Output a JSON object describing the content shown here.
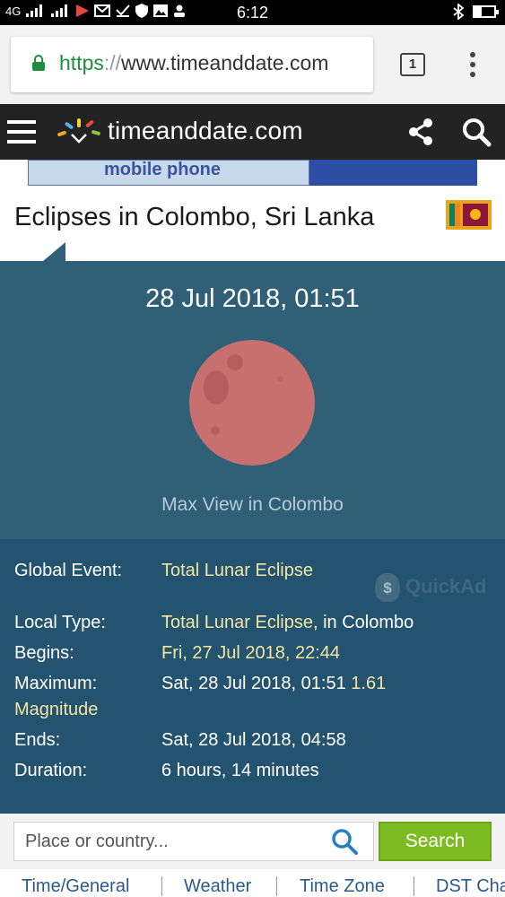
{
  "status_bar": {
    "network": "4G",
    "time": "6:12"
  },
  "browser": {
    "url_scheme": "https",
    "url_separator": "://",
    "url_host": "www.timeanddate.com",
    "tab_count": "1"
  },
  "site": {
    "name": "timeanddate.com"
  },
  "ad": {
    "text": "mobile phone"
  },
  "page": {
    "title": "Eclipses in Colombo, Sri Lanka"
  },
  "eclipse": {
    "datetime": "28 Jul 2018, 01:51",
    "caption": "Max View in Colombo"
  },
  "details": {
    "global_event_label": "Global Event:",
    "global_event_value": "Total Lunar Eclipse",
    "local_type_label": "Local Type:",
    "local_type_value": "Total Lunar Eclipse",
    "local_type_suffix": ", in Colombo",
    "begins_label": "Begins:",
    "begins_value": "Fri, 27 Jul 2018, 22:44",
    "maximum_label": "Maximum:",
    "maximum_value": "Sat, 28 Jul 2018, 01:51",
    "maximum_magnitude_value": "1.61",
    "magnitude_label": "Magnitude",
    "ends_label": "Ends:",
    "ends_value": "Sat, 28 Jul 2018, 04:58",
    "duration_label": "Duration:",
    "duration_value": "6 hours, 14 minutes"
  },
  "watermark": {
    "text": "QuickAd",
    "symbol": "$"
  },
  "search": {
    "placeholder": "Place or country...",
    "button_label": "Search"
  },
  "bottom_nav": {
    "items": [
      "Time/General",
      "Weather",
      "Time Zone",
      "DST Cha"
    ]
  }
}
